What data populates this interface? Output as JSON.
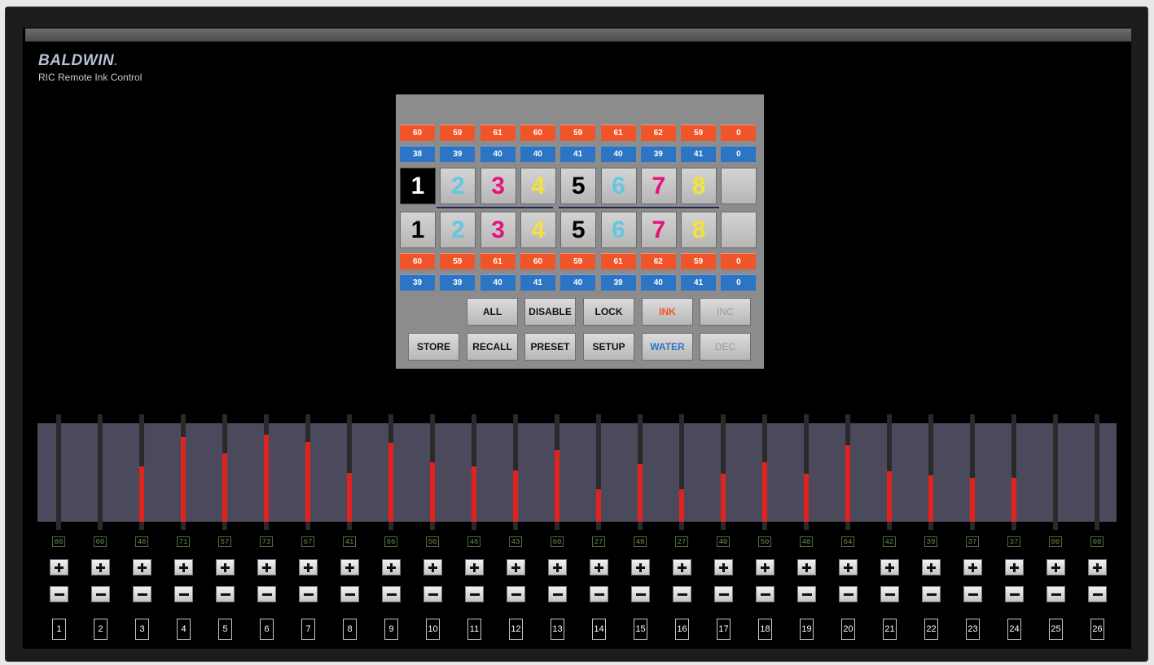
{
  "brand": {
    "name": "BALDWIN",
    "mark": ".",
    "subtitle": "RIC Remote Ink Control"
  },
  "panel": {
    "top_ink": [
      "60",
      "59",
      "61",
      "60",
      "59",
      "61",
      "62",
      "59",
      "0"
    ],
    "top_water": [
      "38",
      "39",
      "40",
      "40",
      "41",
      "40",
      "39",
      "41",
      "0"
    ],
    "units_top": [
      "1",
      "2",
      "3",
      "4",
      "5",
      "6",
      "7",
      "8",
      ""
    ],
    "units_bottom": [
      "1",
      "2",
      "3",
      "4",
      "5",
      "6",
      "7",
      "8",
      ""
    ],
    "unit_colors": [
      "#000000",
      "#63c6e3",
      "#e5127d",
      "#f5e33c",
      "#000000",
      "#63c6e3",
      "#e5127d",
      "#f5e33c",
      "#000000"
    ],
    "bottom_ink": [
      "60",
      "59",
      "61",
      "60",
      "59",
      "61",
      "62",
      "59",
      "0"
    ],
    "bottom_water": [
      "39",
      "39",
      "40",
      "41",
      "40",
      "39",
      "40",
      "41",
      "0"
    ],
    "buttons": {
      "all": "ALL",
      "disable": "DISABLE",
      "lock": "LOCK",
      "ink": "INK",
      "inc": "INC",
      "store": "STORE",
      "recall": "RECALL",
      "preset": "PRESET",
      "setup": "SETUP",
      "water": "WATER",
      "dec": "DEC"
    },
    "colors": {
      "ink": "#f0552a",
      "water": "#2c74c4",
      "disabled": "#9a9a9a"
    }
  },
  "keys": {
    "values": [
      "00",
      "00",
      "46",
      "71",
      "57",
      "73",
      "67",
      "41",
      "66",
      "50",
      "46",
      "43",
      "60",
      "27",
      "48",
      "27",
      "40",
      "50",
      "40",
      "64",
      "42",
      "39",
      "37",
      "37",
      "00",
      "00"
    ],
    "levels": [
      0,
      0,
      46,
      71,
      57,
      73,
      67,
      41,
      66,
      50,
      46,
      43,
      60,
      27,
      48,
      27,
      40,
      50,
      40,
      64,
      42,
      39,
      37,
      37,
      0,
      0
    ],
    "numbers": [
      "1",
      "2",
      "3",
      "4",
      "5",
      "6",
      "7",
      "8",
      "9",
      "10",
      "11",
      "12",
      "13",
      "14",
      "15",
      "16",
      "17",
      "18",
      "19",
      "20",
      "21",
      "22",
      "23",
      "24",
      "25",
      "26"
    ]
  }
}
